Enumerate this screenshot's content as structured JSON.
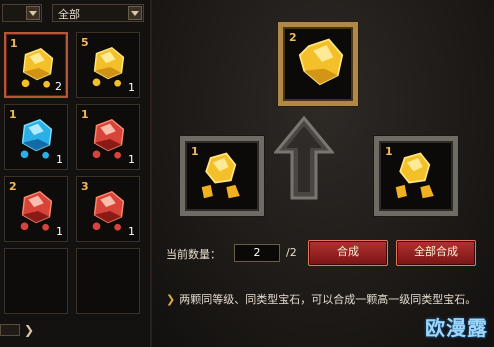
{
  "filters": {
    "type_value": "",
    "category_value": "全部"
  },
  "inventory": [
    {
      "level": "1",
      "count": "2",
      "color": "gold",
      "selected": true
    },
    {
      "level": "5",
      "count": "1",
      "color": "gold",
      "selected": false
    },
    {
      "level": "1",
      "count": "1",
      "color": "blue",
      "selected": false
    },
    {
      "level": "1",
      "count": "1",
      "color": "red",
      "selected": false
    },
    {
      "level": "2",
      "count": "1",
      "color": "red",
      "selected": false
    },
    {
      "level": "3",
      "count": "1",
      "color": "red",
      "selected": false
    },
    {
      "level": "",
      "count": "",
      "color": "",
      "selected": false
    },
    {
      "level": "",
      "count": "",
      "color": "",
      "selected": false
    }
  ],
  "synthesis": {
    "result": {
      "level": "2",
      "color": "gold"
    },
    "left_input": {
      "level": "1",
      "color": "gold"
    },
    "right_input": {
      "level": "1",
      "color": "gold"
    }
  },
  "controls": {
    "qty_label": "当前数量：",
    "qty_value": "2",
    "qty_max": "/2",
    "combine_label": "合成",
    "combine_all_label": "全部合成"
  },
  "tip": {
    "text": "两颗同等级、同类型宝石，可以合成一颗高一级同类型宝石。"
  },
  "watermark": "欧漫露",
  "colors": {
    "frame_gold": "#b08848",
    "frame_grey": "#6e6a64",
    "button_red": "#b23232",
    "level_text": "#f0b85a"
  }
}
